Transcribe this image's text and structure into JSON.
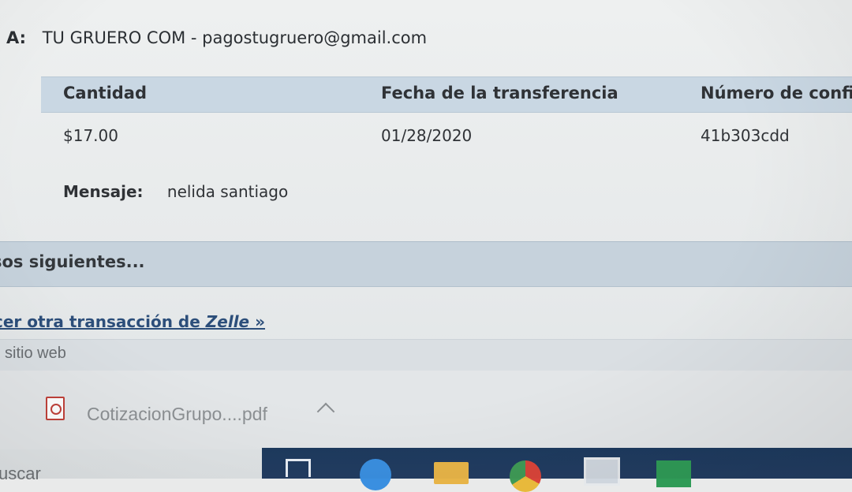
{
  "recipient": {
    "label": "A:",
    "value": "TU GRUERO COM - pagostugruero@gmail.com"
  },
  "transfer_table": {
    "headers": [
      "Cantidad",
      "Fecha de la transferencia",
      "Número de confi"
    ],
    "row": [
      "$17.00",
      "01/28/2020",
      "41b303cdd"
    ]
  },
  "message": {
    "label": "Mensaje:",
    "value": "nelida santiago"
  },
  "next_steps": {
    "heading": "sos siguientes..."
  },
  "zelle_link": {
    "prefix": "cer otra transacción de ",
    "brand": "Zelle",
    "suffix": " »"
  },
  "site_link": {
    "label": "l sitio web"
  },
  "download": {
    "filename": "CotizacionGrupo....pdf"
  },
  "taskbar": {
    "search_text": "uscar"
  },
  "colors": {
    "header_band": "#c9d7e3",
    "link": "#2c4e7a",
    "taskbar": "#1d3a5e"
  },
  "icons": [
    "pdf-icon",
    "chevron-up-icon",
    "task-view-icon",
    "edge-icon",
    "file-explorer-icon",
    "chrome-icon",
    "app-icon",
    "excel-icon"
  ]
}
